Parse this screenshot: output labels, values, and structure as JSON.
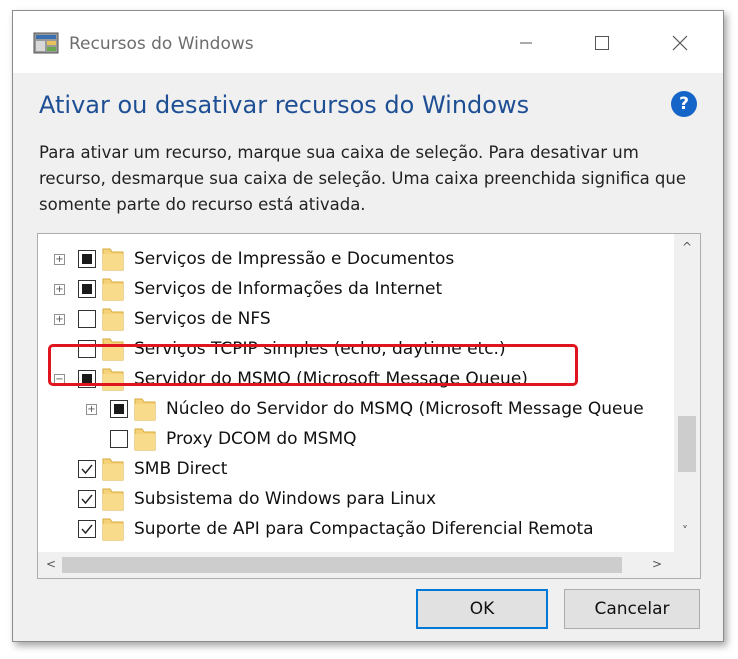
{
  "window": {
    "title": "Recursos do Windows",
    "minimize_label": "—",
    "maximize_label": "☐",
    "close_label": "✕"
  },
  "heading": "Ativar ou desativar recursos do Windows",
  "help_label": "?",
  "description": "Para ativar um recurso, marque sua caixa de seleção. Para desativar um recurso, desmarque sua caixa de seleção. Uma caixa preenchida significa que somente parte do recurso está ativada.",
  "features": [
    {
      "label": "Serviços de Impressão e Documentos",
      "state": "partial",
      "expander": "+",
      "level": 0
    },
    {
      "label": "Serviços de Informações da Internet",
      "state": "partial",
      "expander": "+",
      "level": 0
    },
    {
      "label": "Serviços de NFS",
      "state": "unchecked",
      "expander": "+",
      "level": 0
    },
    {
      "label": "Serviços TCPIP simples (echo, daytime etc.)",
      "state": "unchecked",
      "expander": "",
      "level": 0
    },
    {
      "label": "Servidor do MSMQ (Microsoft Message Queue)",
      "state": "partial",
      "expander": "−",
      "level": 0
    },
    {
      "label": "Núcleo do Servidor do MSMQ (Microsoft Message Queue",
      "state": "partial",
      "expander": "+",
      "level": 1
    },
    {
      "label": "Proxy DCOM do MSMQ",
      "state": "unchecked",
      "expander": "",
      "level": 1
    },
    {
      "label": "SMB Direct",
      "state": "checked",
      "expander": "",
      "level": 0
    },
    {
      "label": "Subsistema do Windows para Linux",
      "state": "checked",
      "expander": "",
      "level": 0
    },
    {
      "label": "Suporte de API para Compactação Diferencial Remota",
      "state": "checked",
      "expander": "",
      "level": 0
    }
  ],
  "scroll": {
    "up": "^",
    "down": "˅",
    "left": "<",
    "right": ">"
  },
  "buttons": {
    "ok": "OK",
    "cancel": "Cancelar"
  },
  "colors": {
    "heading": "#1e4f94",
    "highlight": "#e0141e",
    "accent": "#0078d7"
  }
}
